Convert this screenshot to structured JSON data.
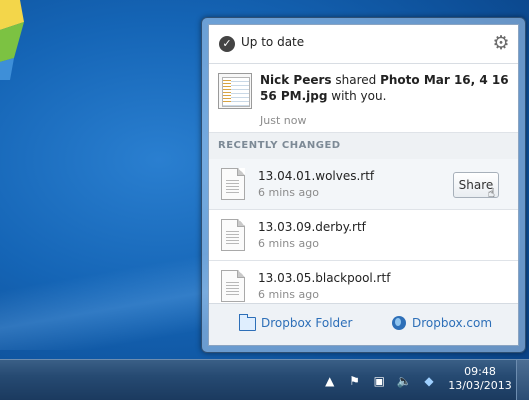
{
  "popup": {
    "status_text": "Up to date",
    "notification": {
      "sender": "Nick Peers",
      "action": " shared ",
      "item": "Photo Mar 16, 4 16 56 PM.jpg",
      "suffix": " with you.",
      "time": "Just now"
    },
    "section_title": "RECENTLY CHANGED",
    "files": [
      {
        "name": "13.04.01.wolves.rtf",
        "time": "6 mins ago"
      },
      {
        "name": "13.03.09.derby.rtf",
        "time": "6 mins ago"
      },
      {
        "name": "13.03.05.blackpool.rtf",
        "time": "6 mins ago"
      }
    ],
    "share_label": "Share",
    "footer": {
      "folder_link": "Dropbox Folder",
      "web_link": "Dropbox.com"
    }
  },
  "taskbar": {
    "time": "09:48",
    "date": "13/03/2013"
  },
  "icons": {
    "status": "check-circle-icon",
    "settings": "gear-icon",
    "folder": "folder-icon",
    "web": "globe-icon"
  }
}
